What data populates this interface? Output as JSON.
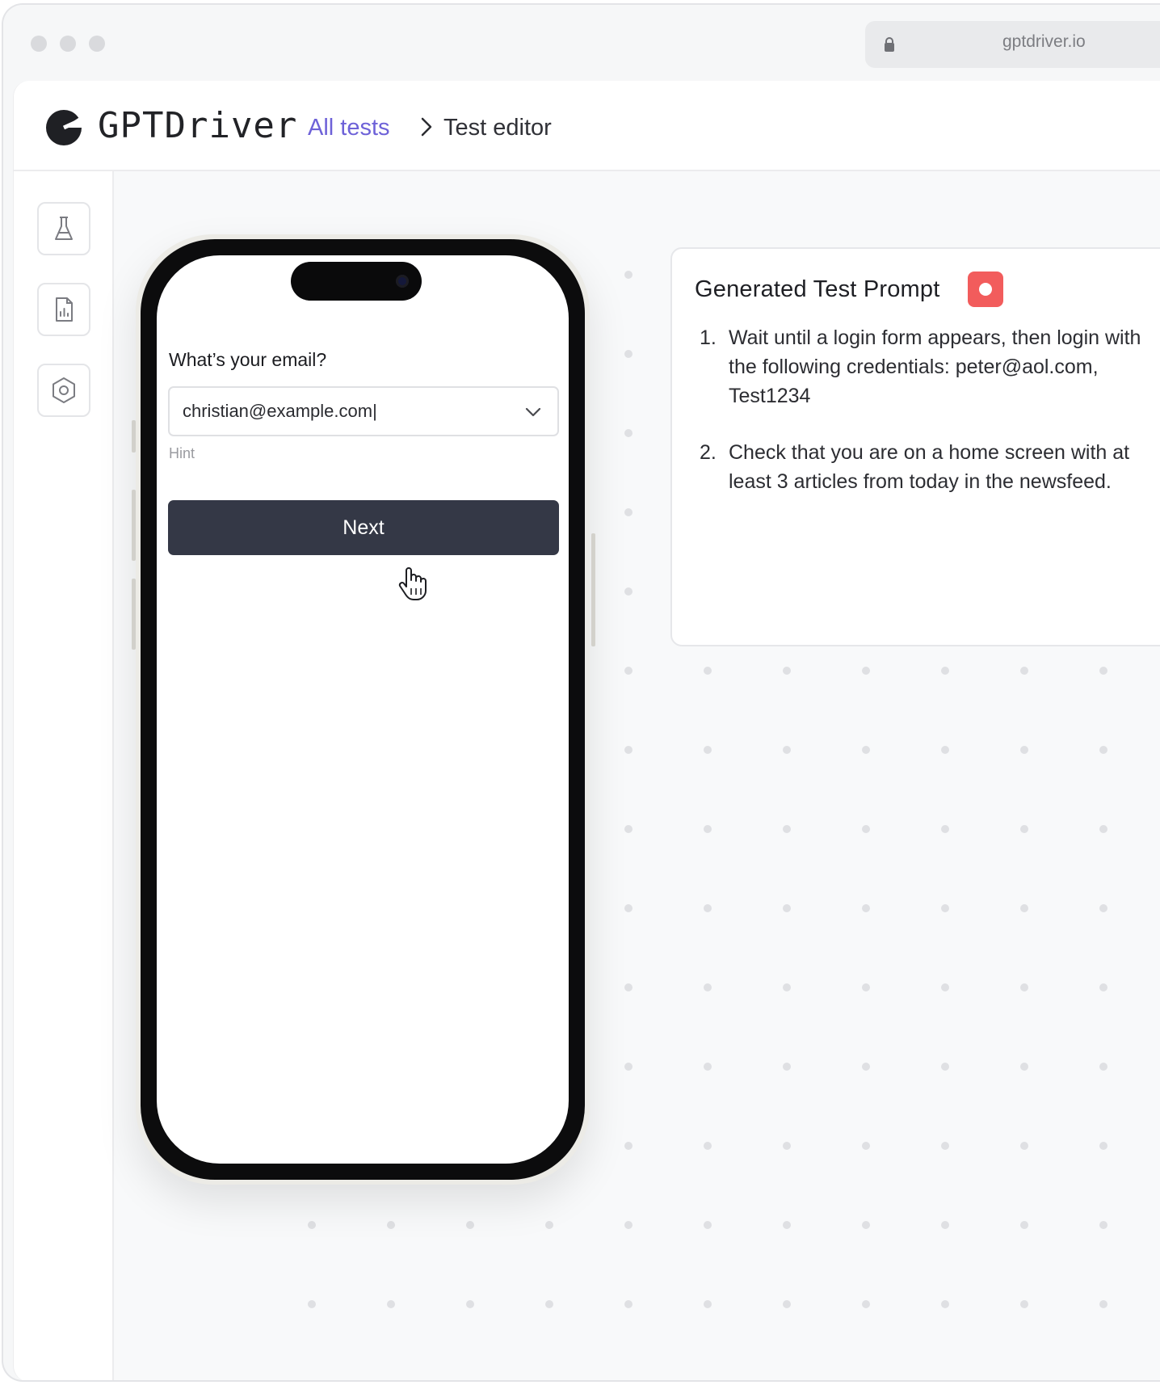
{
  "browser": {
    "url": "gptdriver.io"
  },
  "header": {
    "brand": "GPTDriver",
    "breadcrumb": {
      "link_label": "All tests",
      "current_label": "Test editor"
    }
  },
  "sidebar": {
    "items": [
      {
        "icon": "flask-icon"
      },
      {
        "icon": "report-icon"
      },
      {
        "icon": "settings-hexagon-icon"
      }
    ]
  },
  "phone": {
    "question": "What’s your email?",
    "email_value": "christian@example.com|",
    "hint": "Hint",
    "next_label": "Next"
  },
  "prompt": {
    "title": "Generated Test Prompt",
    "steps": [
      {
        "num": "1.",
        "text": "Wait until a login form appears, then login with the following credentials: peter@aol.com, Test1234"
      },
      {
        "num": "2.",
        "text": "Check that you are on a home screen with at least 3 articles from today in the newsfeed."
      }
    ]
  },
  "colors": {
    "accent_link": "#6e62d8",
    "button_dark": "#343846",
    "record_red": "#f25c5c"
  }
}
